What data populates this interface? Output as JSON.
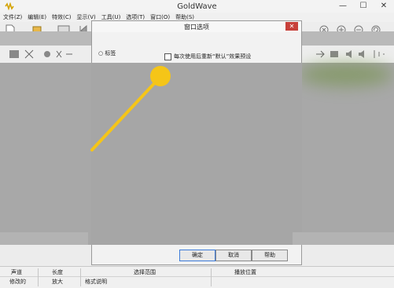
{
  "app": {
    "title": "GoldWave"
  },
  "window_controls": {
    "minimize": "—",
    "maximize": "☐",
    "close": "✕"
  },
  "menu": {
    "items": [
      "文件(Z)",
      "编辑(E)",
      "特效(C)",
      "显示(V)",
      "工具(U)",
      "选项(T)",
      "窗口(O)",
      "帮助(S)"
    ]
  },
  "dialog": {
    "title": "窗口选项",
    "close_glyph": "✕",
    "radio_label": "标签",
    "checkboxes": [
      {
        "label": "每次使用后重新“默认”效果预设",
        "checked": false
      }
    ],
    "buttons": {
      "ok": "确定",
      "cancel": "取消",
      "help": "帮助"
    }
  },
  "status": {
    "row1": {
      "channel": "声道",
      "length": "长度",
      "selection": "选择范围",
      "playback": "播放位置"
    },
    "row2": {
      "modified": "修改的",
      "zoom": "放大",
      "format": "格式说明"
    }
  },
  "colors": {
    "accent_yellow": "#f5c518",
    "dialog_close": "#c7403a"
  }
}
